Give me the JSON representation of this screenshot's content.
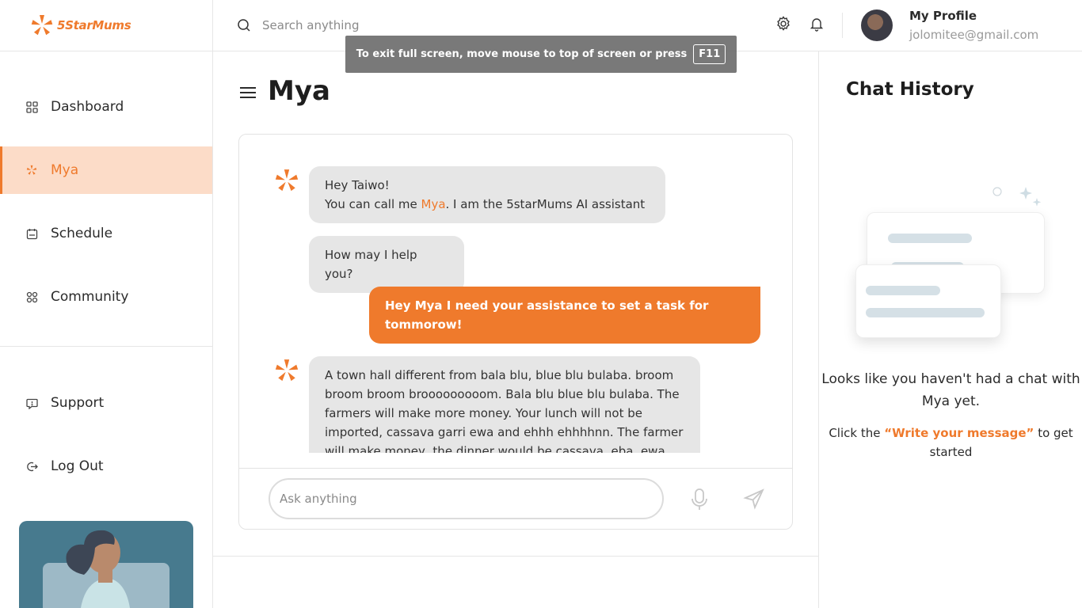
{
  "brand": {
    "name": "5StarMums",
    "accent": "#ef7a2c"
  },
  "search": {
    "placeholder": "Search anything"
  },
  "profile": {
    "name": "My Profile",
    "email": "jolomitee@gmail.com"
  },
  "toast": {
    "text": "To exit full screen, move mouse to top of screen or press",
    "key": "F11"
  },
  "sidebar": {
    "items": [
      {
        "label": "Dashboard",
        "icon": "grid-icon"
      },
      {
        "label": "Mya",
        "icon": "star-logo-icon",
        "active": true
      },
      {
        "label": "Schedule",
        "icon": "calendar-icon"
      },
      {
        "label": "Community",
        "icon": "community-icon"
      }
    ],
    "bottom_items": [
      {
        "label": "Support",
        "icon": "chat-help-icon"
      },
      {
        "label": "Log Out",
        "icon": "logout-icon"
      }
    ]
  },
  "page": {
    "title": "Mya"
  },
  "chat": {
    "messages": [
      {
        "from": "bot",
        "line1": "Hey Taiwo!",
        "line2_pre": "You can call me ",
        "line2_hl": "Mya",
        "line2_post": ". I am the 5starMums AI assistant"
      },
      {
        "from": "bot",
        "text": "How may I help you?"
      },
      {
        "from": "user",
        "text": "Hey Mya I need your assistance to set a task for tommorow!"
      },
      {
        "from": "bot",
        "text": "A town hall different from bala blu, blue blu bulaba. broom broom broom brooooooooom. Bala blu blue blu bulaba. The farmers will make more money. Your lunch will not be imported, cassava garri ewa and ehhh ehhhhnn. The farmer will make money, the dinner would be cassava, eba, ewa"
      }
    ],
    "input_placeholder": "Ask anything"
  },
  "history": {
    "title": "Chat History",
    "empty_text": "Looks like you haven't had a chat with Mya yet.",
    "cta_pre": "Click the ",
    "cta_quote": "“Write your message”",
    "cta_post": " to get started"
  }
}
